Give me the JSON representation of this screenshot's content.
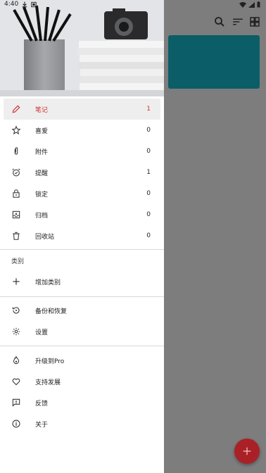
{
  "status_bar": {
    "time": "4:40"
  },
  "drawer": {
    "primary_items": [
      {
        "label": "笔记",
        "count": "1",
        "icon": "pencil-icon",
        "selected": true
      },
      {
        "label": "喜爱",
        "count": "0",
        "icon": "star-icon"
      },
      {
        "label": "附件",
        "count": "0",
        "icon": "paperclip-icon"
      },
      {
        "label": "提醒",
        "count": "1",
        "icon": "alarm-icon"
      },
      {
        "label": "锁定",
        "count": "0",
        "icon": "lock-icon"
      },
      {
        "label": "归档",
        "count": "0",
        "icon": "archive-icon"
      },
      {
        "label": "回收站",
        "count": "0",
        "icon": "trash-icon"
      }
    ],
    "categories_header": "类别",
    "add_category": "增加类别",
    "backup_label": "备份和恢复",
    "settings_label": "设置",
    "bottom_items": [
      {
        "label": "升级到Pro",
        "icon": "flame-icon"
      },
      {
        "label": "支持发展",
        "icon": "heart-icon"
      },
      {
        "label": "反馈",
        "icon": "feedback-icon"
      },
      {
        "label": "关于",
        "icon": "info-icon"
      }
    ]
  },
  "colors": {
    "accent": "#d32f2f",
    "note_card": "#0b5d68",
    "fab": "#a92126"
  }
}
